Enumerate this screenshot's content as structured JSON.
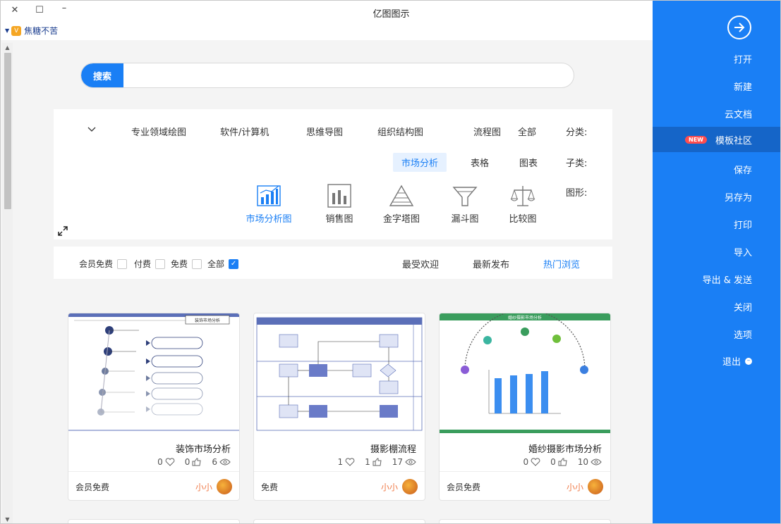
{
  "window": {
    "title": "亿图图示",
    "close": "✕",
    "maximize": "☐",
    "minimize": "–"
  },
  "user": {
    "name": "焦糖不苦",
    "badge": "V"
  },
  "search": {
    "button": "搜索",
    "placeholder": ""
  },
  "categories": {
    "label": "分类:",
    "items": [
      "全部",
      "流程图",
      "组织结构图",
      "思维导图",
      "软件/计算机",
      "专业领域绘图"
    ]
  },
  "subcategories": {
    "label": "子类:",
    "items": [
      "图表",
      "表格",
      "市场分析"
    ],
    "active": "市场分析"
  },
  "shapes": {
    "label": "图形:",
    "items": [
      {
        "label": "比较图",
        "icon": "scale-icon"
      },
      {
        "label": "漏斗图",
        "icon": "funnel-icon"
      },
      {
        "label": "金字塔图",
        "icon": "pyramid-icon"
      },
      {
        "label": "销售图",
        "icon": "bar-chart-icon"
      },
      {
        "label": "市场分析图",
        "icon": "market-chart-icon"
      }
    ],
    "active": "市场分析图"
  },
  "filters": {
    "checks": [
      {
        "label": "全部",
        "checked": true
      },
      {
        "label": "免费",
        "checked": false
      },
      {
        "label": "付费",
        "checked": false
      },
      {
        "label": "会员免费",
        "checked": false
      }
    ],
    "sorts": [
      "热门浏览",
      "最新发布",
      "最受欢迎"
    ],
    "active_sort": "热门浏览"
  },
  "cards": [
    {
      "title": "婚纱摄影市场分析",
      "views": "10",
      "likes": "0",
      "favs": "0",
      "author": "小小",
      "price": "会员免费",
      "thumb_title": "婚纱摄影市场分析"
    },
    {
      "title": "摄影棚流程",
      "views": "17",
      "likes": "1",
      "favs": "1",
      "author": "小小",
      "price": "免费",
      "thumb_title": ""
    },
    {
      "title": "装饰市场分析",
      "views": "6",
      "likes": "0",
      "favs": "0",
      "author": "小小",
      "price": "会员免费",
      "thumb_title": "装饰市场分析"
    }
  ],
  "sidebar": {
    "items": [
      "打开",
      "新建",
      "云文档",
      "模板社区",
      "保存",
      "另存为",
      "打印",
      "导入",
      "导出 & 发送",
      "关闭",
      "选项",
      "退出"
    ],
    "active": "模板社区",
    "new_badge": "NEW"
  },
  "colors": {
    "accent": "#1a7ff5",
    "sidebar": "#1a7ff5",
    "author": "#f07b4a"
  }
}
